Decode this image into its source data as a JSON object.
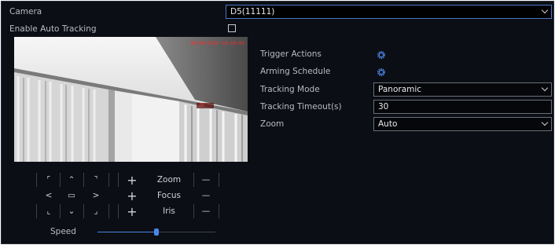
{
  "camera": {
    "label": "Camera",
    "value": "D5(11111)"
  },
  "auto_tracking": {
    "label": "Enable Auto Tracking",
    "checked": false
  },
  "video": {
    "osd_time": "08/08/2024 16:20:03",
    "tag": "D5"
  },
  "trigger_actions": {
    "label": "Trigger Actions",
    "icon": "gear-icon"
  },
  "arming_schedule": {
    "label": "Arming Schedule",
    "icon": "gear-icon"
  },
  "tracking_mode": {
    "label": "Tracking Mode",
    "value": "Panoramic"
  },
  "tracking_timeout": {
    "label": "Tracking Timeout(s)",
    "value": "30"
  },
  "zoom_setting": {
    "label": "Zoom",
    "value": "Auto"
  },
  "ptz": {
    "zoom_label": "Zoom",
    "focus_label": "Focus",
    "iris_label": "Iris",
    "plus": "+",
    "minus": "—",
    "arrows": {
      "up_left": "⌜",
      "up": "⌃",
      "up_right": "⌝",
      "left": "<",
      "center": "▭",
      "right": ">",
      "down_left": "⌞",
      "down": "⌄",
      "down_right": "⌟"
    }
  },
  "speed": {
    "label": "Speed",
    "level": 0.5
  },
  "colors": {
    "accent": "#4a86e8",
    "background": "#0b0e14",
    "border": "#6b6f78"
  }
}
